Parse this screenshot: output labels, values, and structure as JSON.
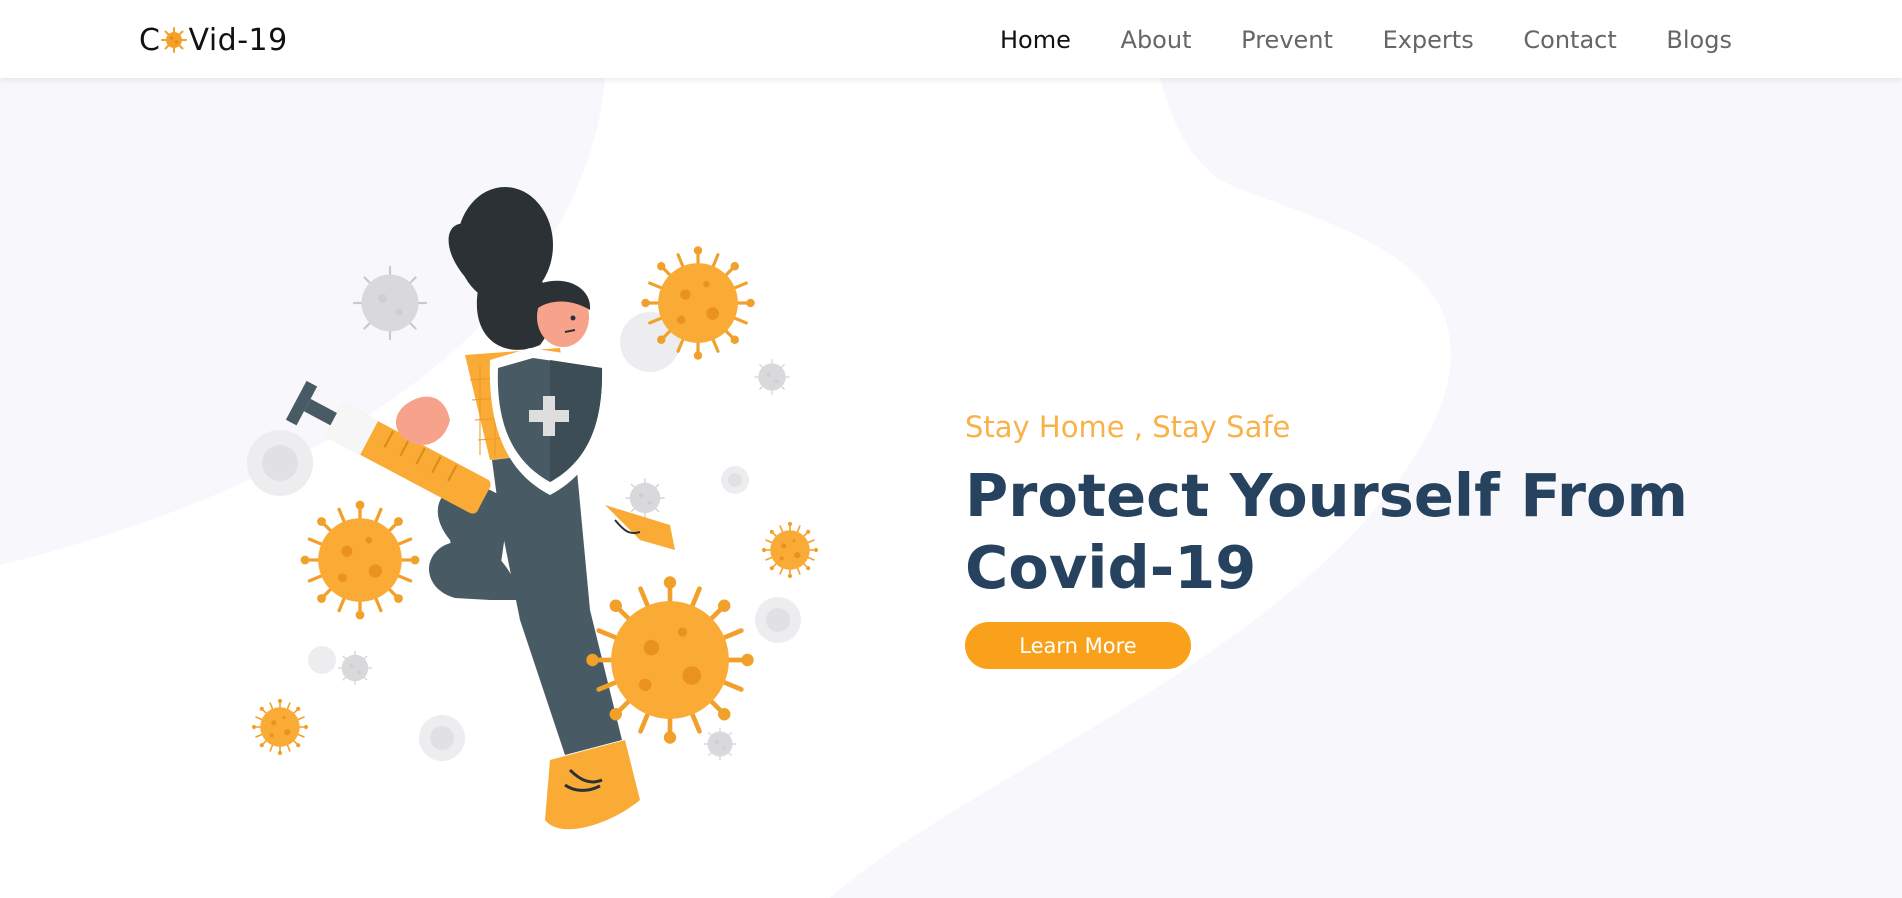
{
  "brand": {
    "prefix": "C",
    "suffix": "Vid-19",
    "logo_icon": "virus-icon",
    "accent": "#f9a11b"
  },
  "nav": {
    "items": [
      {
        "label": "Home",
        "active": true
      },
      {
        "label": "About"
      },
      {
        "label": "Prevent"
      },
      {
        "label": "Experts"
      },
      {
        "label": "Contact"
      },
      {
        "label": "Blogs"
      }
    ]
  },
  "hero": {
    "tagline": "Stay Home , Stay Safe",
    "title_line1": "Protect Yourself From",
    "title_line2": "Covid-19",
    "cta_label": "Learn More",
    "illustration": "woman-with-shield-and-syringe-illustration"
  },
  "colors": {
    "tagline": "#f9b24a",
    "headline": "#26425f",
    "button": "#f9a11b",
    "background_blob": "#f7f7fc"
  }
}
